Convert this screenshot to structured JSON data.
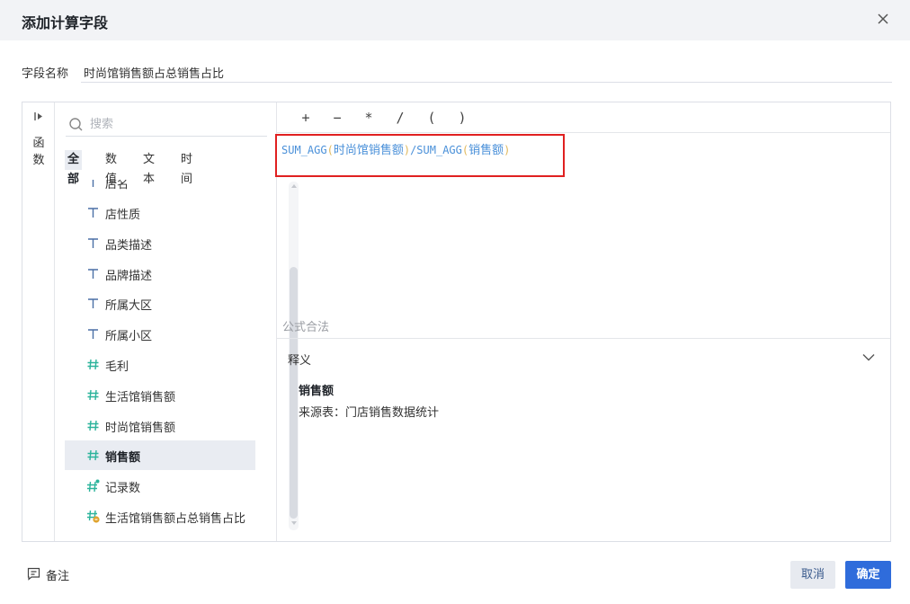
{
  "dialog": {
    "title": "添加计算字段"
  },
  "field_name": {
    "label": "字段名称",
    "value": "时尚馆销售额占总销售占比"
  },
  "side_strip": {
    "label": "函数"
  },
  "search": {
    "placeholder": "搜索"
  },
  "filter_tabs": [
    {
      "label": "全部",
      "active": true
    },
    {
      "label": "数值",
      "active": false
    },
    {
      "label": "文本",
      "active": false
    },
    {
      "label": "时间",
      "active": false
    }
  ],
  "fields": [
    {
      "label": "店名",
      "icon": "text-type-icon",
      "partial": true
    },
    {
      "label": "店性质",
      "icon": "text-type-icon"
    },
    {
      "label": "品类描述",
      "icon": "text-type-icon"
    },
    {
      "label": "品牌描述",
      "icon": "text-type-icon"
    },
    {
      "label": "所属大区",
      "icon": "text-type-icon"
    },
    {
      "label": "所属小区",
      "icon": "text-type-icon"
    },
    {
      "label": "毛利",
      "icon": "number-type-icon"
    },
    {
      "label": "生活馆销售额",
      "icon": "number-type-icon"
    },
    {
      "label": "时尚馆销售额",
      "icon": "number-type-icon"
    },
    {
      "label": "销售额",
      "icon": "number-type-icon",
      "selected": true
    },
    {
      "label": "记录数",
      "icon": "record-count-icon"
    },
    {
      "label": "生活馆销售额占总销售占比",
      "icon": "calculated-field-icon"
    }
  ],
  "operators": [
    "+",
    "−",
    "*",
    "/",
    "(",
    ")"
  ],
  "formula": {
    "func1": "SUM_AGG",
    "open1": "(",
    "field1": "时尚馆销售额",
    "close1": ")",
    "divider": "/",
    "func2": "SUM_AGG",
    "open2": "(",
    "field2": "销售额",
    "close2": ")"
  },
  "validity_text": "公式合法",
  "explanation": {
    "title": "释义",
    "field_name": "销售额",
    "source": "来源表：门店销售数据统计"
  },
  "footer": {
    "note_label": "备注",
    "cancel_label": "取消",
    "ok_label": "确定"
  },
  "colors": {
    "primary": "#2f6cdb",
    "formula_func": "#4a90d9",
    "formula_paren": "#e0b85c",
    "number_icon": "#2bb39b",
    "text_icon": "#4a6fa5",
    "highlight": "#e02020"
  }
}
